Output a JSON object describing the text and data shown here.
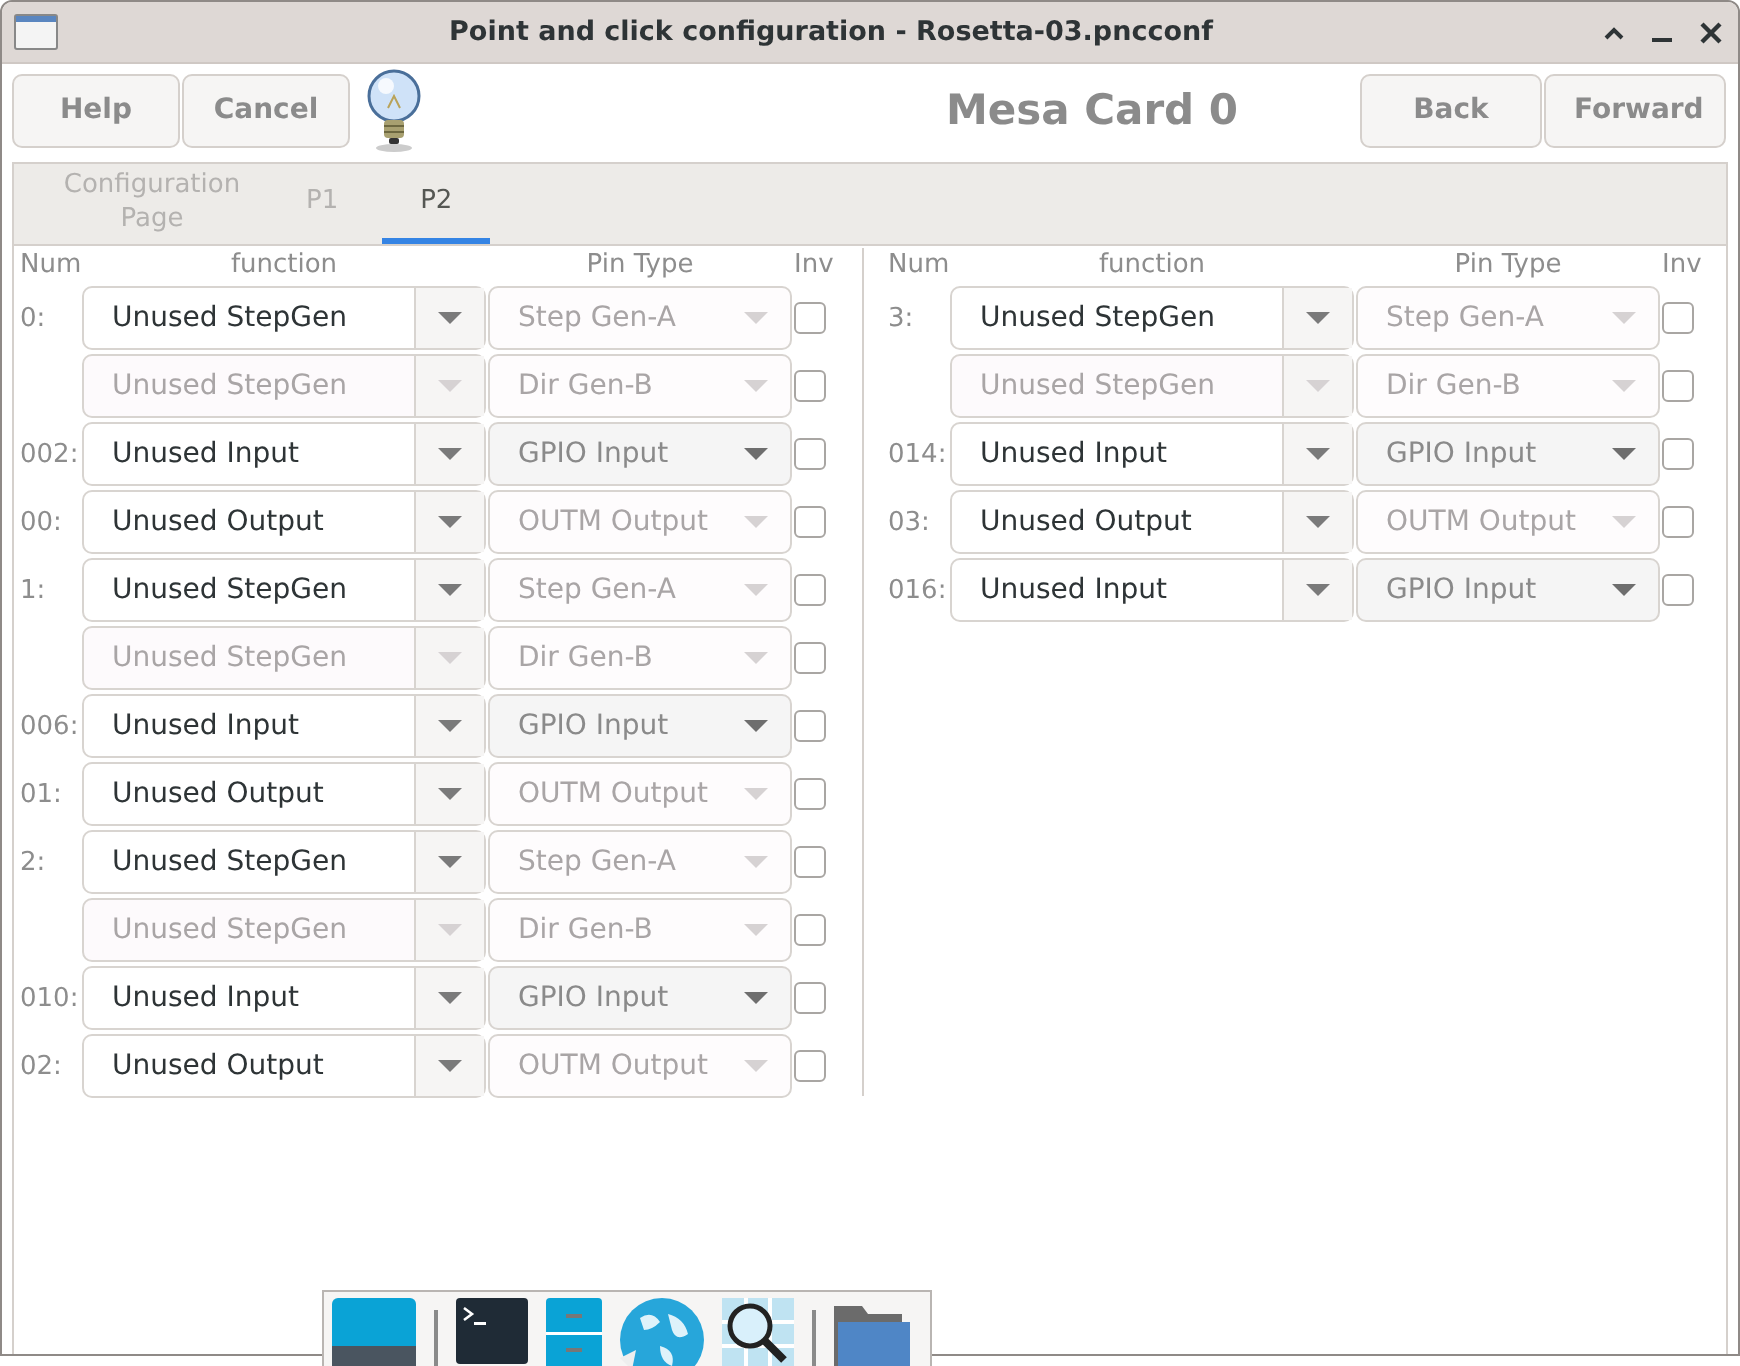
{
  "window": {
    "title": "Point and click configuration - Rosetta-03.pncconf"
  },
  "toolbar": {
    "buttons_left": [
      "Help",
      "Cancel"
    ],
    "heading": "Mesa Card 0",
    "buttons_right": [
      "Back",
      "Forward"
    ]
  },
  "tabs": [
    {
      "label": "Configuration Page",
      "selected": false
    },
    {
      "label": "P1",
      "selected": false
    },
    {
      "label": "P2",
      "selected": true
    }
  ],
  "columns": [
    {
      "headers": [
        "Num",
        "function",
        "Pin Type",
        "Inv"
      ],
      "rows": [
        {
          "num": "0:",
          "function": {
            "value": "Unused StepGen",
            "disabled": false
          },
          "pin_type": {
            "value": "Step Gen-A",
            "disabled": true
          },
          "inv": {
            "checked": false
          }
        },
        {
          "function": {
            "value": "Unused StepGen",
            "disabled": true
          },
          "pin_type": {
            "value": "Dir Gen-B",
            "disabled": true
          },
          "inv": {
            "checked": false
          }
        },
        {
          "num": "002:",
          "function": {
            "value": "Unused Input",
            "disabled": false
          },
          "pin_type": {
            "value": "GPIO Input",
            "disabled": false
          },
          "inv": {
            "checked": false
          }
        },
        {
          "num": "00:",
          "function": {
            "value": "Unused Output",
            "disabled": false
          },
          "pin_type": {
            "value": "OUTM Output",
            "disabled": true
          },
          "inv": {
            "checked": false
          }
        },
        {
          "num": "1:",
          "function": {
            "value": "Unused StepGen",
            "disabled": false
          },
          "pin_type": {
            "value": "Step Gen-A",
            "disabled": true
          },
          "inv": {
            "checked": false
          }
        },
        {
          "function": {
            "value": "Unused StepGen",
            "disabled": true
          },
          "pin_type": {
            "value": "Dir Gen-B",
            "disabled": true
          },
          "inv": {
            "checked": false
          }
        },
        {
          "num": "006:",
          "function": {
            "value": "Unused Input",
            "disabled": false
          },
          "pin_type": {
            "value": "GPIO Input",
            "disabled": false
          },
          "inv": {
            "checked": false
          }
        },
        {
          "num": "01:",
          "function": {
            "value": "Unused Output",
            "disabled": false
          },
          "pin_type": {
            "value": "OUTM Output",
            "disabled": true
          },
          "inv": {
            "checked": false
          }
        },
        {
          "num": "2:",
          "function": {
            "value": "Unused StepGen",
            "disabled": false
          },
          "pin_type": {
            "value": "Step Gen-A",
            "disabled": true
          },
          "inv": {
            "checked": false
          }
        },
        {
          "function": {
            "value": "Unused StepGen",
            "disabled": true
          },
          "pin_type": {
            "value": "Dir Gen-B",
            "disabled": true
          },
          "inv": {
            "checked": false
          }
        },
        {
          "num": "010:",
          "function": {
            "value": "Unused Input",
            "disabled": false
          },
          "pin_type": {
            "value": "GPIO Input",
            "disabled": false
          },
          "inv": {
            "checked": false
          }
        },
        {
          "num": "02:",
          "function": {
            "value": "Unused Output",
            "disabled": false
          },
          "pin_type": {
            "value": "OUTM Output",
            "disabled": true
          },
          "inv": {
            "checked": false
          }
        }
      ]
    },
    {
      "headers": [
        "Num",
        "function",
        "Pin Type",
        "Inv"
      ],
      "rows": [
        {
          "num": "3:",
          "function": {
            "value": "Unused StepGen",
            "disabled": false
          },
          "pin_type": {
            "value": "Step Gen-A",
            "disabled": true
          },
          "inv": {
            "checked": false
          }
        },
        {
          "function": {
            "value": "Unused StepGen",
            "disabled": true
          },
          "pin_type": {
            "value": "Dir Gen-B",
            "disabled": true
          },
          "inv": {
            "checked": false
          }
        },
        {
          "num": "014:",
          "function": {
            "value": "Unused Input",
            "disabled": false
          },
          "pin_type": {
            "value": "GPIO Input",
            "disabled": false
          },
          "inv": {
            "checked": false
          }
        },
        {
          "num": "03:",
          "function": {
            "value": "Unused Output",
            "disabled": false
          },
          "pin_type": {
            "value": "OUTM Output",
            "disabled": true
          },
          "inv": {
            "checked": false
          }
        },
        {
          "num": "016:",
          "function": {
            "value": "Unused Input",
            "disabled": false
          },
          "pin_type": {
            "value": "GPIO Input",
            "disabled": false
          },
          "inv": {
            "checked": false
          }
        }
      ]
    }
  ],
  "dock": {
    "items": [
      {
        "kind": "window"
      },
      {
        "kind": "separator"
      },
      {
        "kind": "terminal"
      },
      {
        "kind": "cabinet"
      },
      {
        "kind": "globe"
      },
      {
        "kind": "magnifier"
      },
      {
        "kind": "separator"
      },
      {
        "kind": "folder"
      }
    ]
  }
}
